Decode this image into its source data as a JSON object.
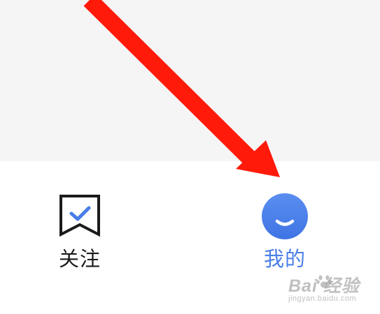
{
  "tab_bar": {
    "tabs": [
      {
        "label": "关注",
        "icon": "bookmark-check-icon",
        "active": false
      },
      {
        "label": "我的",
        "icon": "profile-smile-icon",
        "active": true
      }
    ]
  },
  "annotation": {
    "arrow_color": "#ff1a0a"
  },
  "watermark": {
    "logo": "Bai 经验",
    "site": "jingyan.baidu.com"
  },
  "colors": {
    "content_bg": "#f5f5f6",
    "active_tab": "#4a7ee8",
    "inactive_tab": "#1b1b1b"
  }
}
